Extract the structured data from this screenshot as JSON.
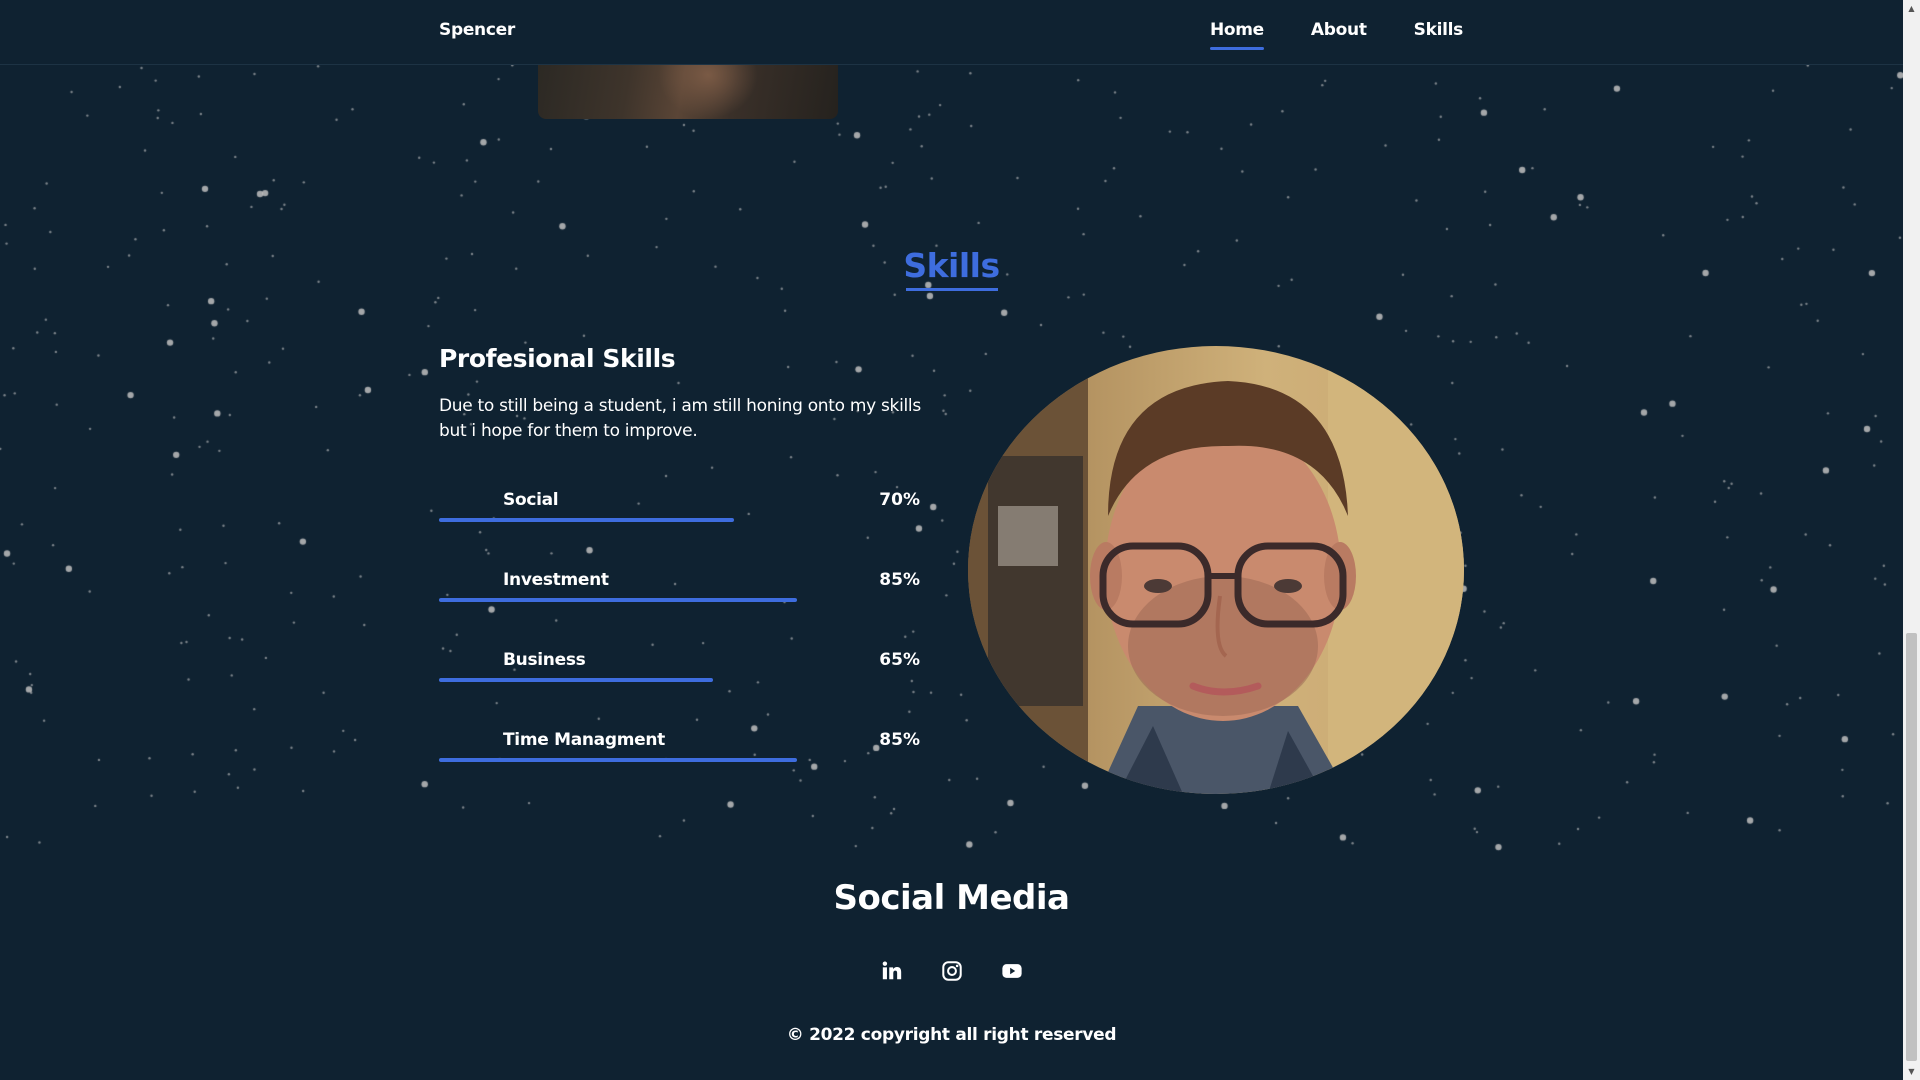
{
  "nav": {
    "brand": "Spencer",
    "links": [
      {
        "label": "Home",
        "active": true
      },
      {
        "label": "About",
        "active": false
      },
      {
        "label": "Skills",
        "active": false
      }
    ]
  },
  "skills_section": {
    "title": "Skills",
    "heading": "Profesional Skills",
    "description": "Due to still being a student, i am still honing onto my skills but i hope for them to improve.",
    "skills": [
      {
        "name": "Social",
        "percent_label": "70%",
        "percent": 70
      },
      {
        "name": "Investment",
        "percent_label": "85%",
        "percent": 85
      },
      {
        "name": "Business",
        "percent_label": "65%",
        "percent": 65
      },
      {
        "name": "Time Managment",
        "percent_label": "85%",
        "percent": 85
      }
    ]
  },
  "social": {
    "title": "Social Media",
    "icons": [
      "linkedin-icon",
      "instagram-icon",
      "youtube-icon"
    ]
  },
  "footer": {
    "copyright": "© 2022 copyright all right reserved"
  },
  "colors": {
    "background": "#0f2231",
    "accent": "#3e6dde",
    "text": "#ffffff"
  }
}
